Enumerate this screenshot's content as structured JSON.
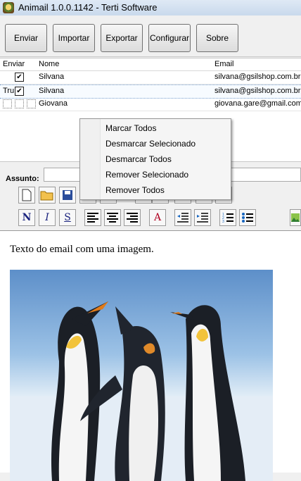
{
  "window": {
    "title": "Animail 1.0.0.1142 - Terti Software"
  },
  "toolbar": {
    "buttons": [
      "Enviar",
      "Importar",
      "Exportar",
      "Configurar",
      "Sobre"
    ]
  },
  "grid": {
    "columns": {
      "send": "Enviar",
      "name": "Nome",
      "email": "Email"
    },
    "rows": [
      {
        "send": "",
        "checked": true,
        "name": "Silvana",
        "email": "silvana@gsilshop.com.br"
      },
      {
        "send": "Tru",
        "checked": true,
        "name": "Silvana",
        "email": "silvana@gsilshop.com.br"
      },
      {
        "send": "",
        "checked": false,
        "name": "Giovana",
        "email": "giovana.gare@gmail.com"
      }
    ]
  },
  "subject": {
    "label": "Assunto:",
    "value": ""
  },
  "context_menu": {
    "items": [
      "Marcar Todos",
      "Desmarcar Selecionado",
      "Desmarcar Todos",
      "Remover Selecionado",
      "Remover Todos"
    ]
  },
  "format_toolbar": {
    "bold": "N",
    "italic": "I",
    "underline": "S",
    "font_color": "A"
  },
  "editor": {
    "body_text": "Texto do email com uma imagem."
  },
  "colors": {
    "menu_bg": "#f5f5f5",
    "editor_bg": "#ffffff",
    "accent": "#1a237e"
  }
}
